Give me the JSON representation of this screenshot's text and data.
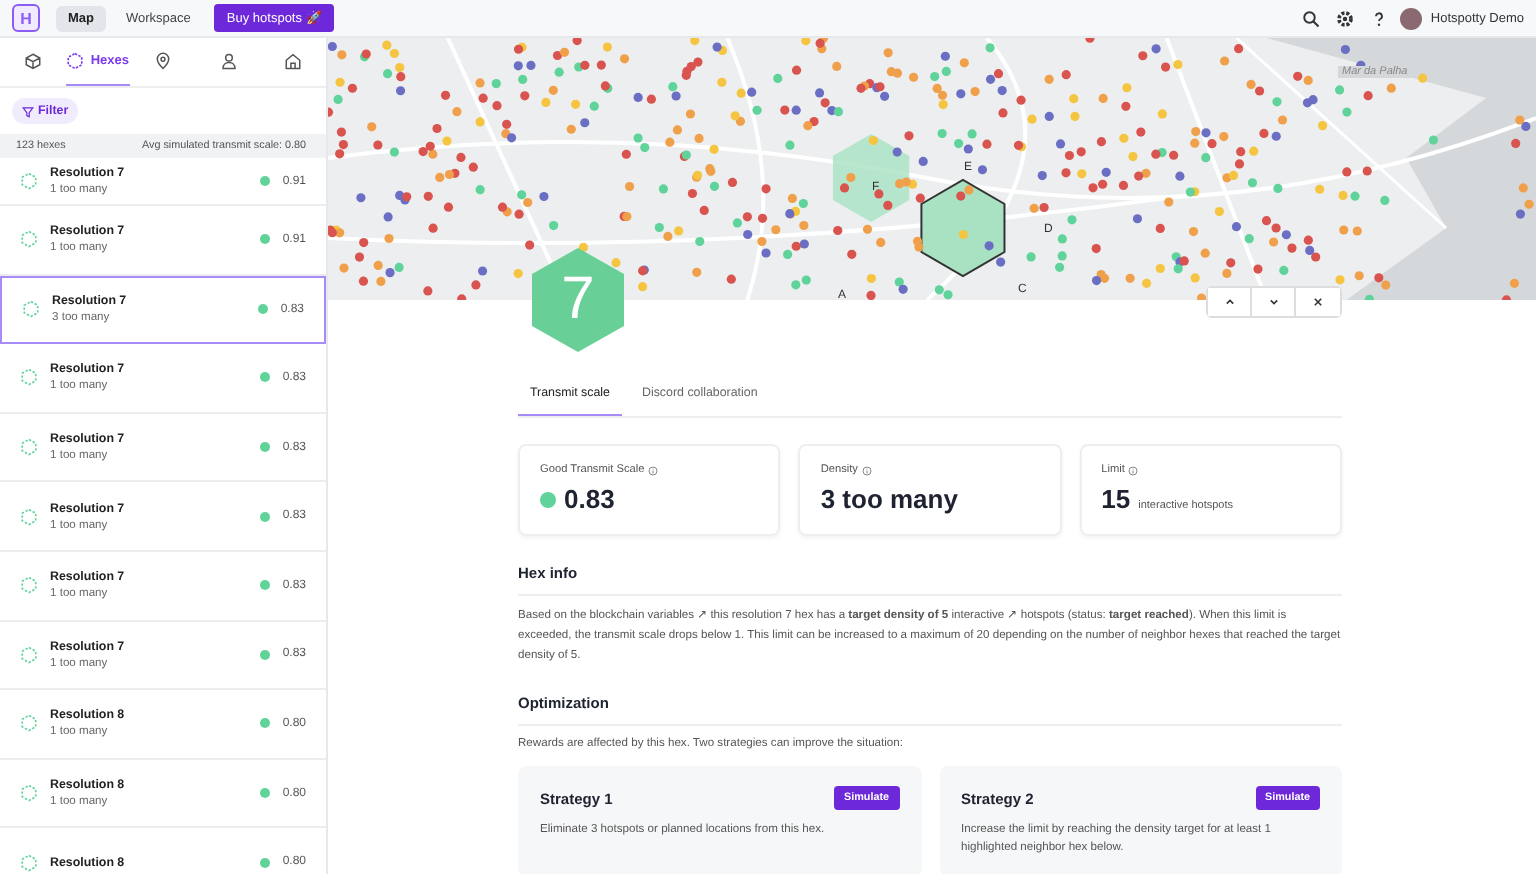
{
  "topbar": {
    "logo": "H",
    "nav": [
      {
        "label": "Map",
        "selected": true
      },
      {
        "label": "Workspace",
        "selected": false
      }
    ],
    "buy_button": "Buy hotspots 🚀",
    "user": "Hotspotty Demo"
  },
  "sidebar": {
    "tabs": [
      {
        "kind": "cube",
        "selected": false
      },
      {
        "kind": "hex",
        "label": "Hexes",
        "selected": true
      },
      {
        "kind": "pin",
        "selected": false
      },
      {
        "kind": "person",
        "selected": false
      },
      {
        "kind": "home",
        "selected": false
      }
    ],
    "filter": "Filter",
    "count": "123 hexes",
    "average": "Avg simulated transmit scale: 0.80",
    "hexes": [
      {
        "title": "Resolution 7",
        "subtitle": "1 too many",
        "score": "0.91",
        "color": "#5fd39a",
        "selected": false
      },
      {
        "title": "Resolution 7",
        "subtitle": "1 too many",
        "score": "0.91",
        "color": "#5fd39a",
        "selected": false
      },
      {
        "title": "Resolution 7",
        "subtitle": "3 too many",
        "score": "0.83",
        "color": "#5fd39a",
        "selected": true
      },
      {
        "title": "Resolution 7",
        "subtitle": "1 too many",
        "score": "0.83",
        "color": "#5fd39a",
        "selected": false
      },
      {
        "title": "Resolution 7",
        "subtitle": "1 too many",
        "score": "0.83",
        "color": "#5fd39a",
        "selected": false
      },
      {
        "title": "Resolution 7",
        "subtitle": "1 too many",
        "score": "0.83",
        "color": "#5fd39a",
        "selected": false
      },
      {
        "title": "Resolution 7",
        "subtitle": "1 too many",
        "score": "0.83",
        "color": "#5fd39a",
        "selected": false
      },
      {
        "title": "Resolution 7",
        "subtitle": "1 too many",
        "score": "0.83",
        "color": "#5fd39a",
        "selected": false
      },
      {
        "title": "Resolution 8",
        "subtitle": "1 too many",
        "score": "0.80",
        "color": "#5fd39a",
        "selected": false
      },
      {
        "title": "Resolution 8",
        "subtitle": "1 too many",
        "score": "0.80",
        "color": "#5fd39a",
        "selected": false
      },
      {
        "title": "Resolution 8",
        "score": "0.80",
        "color": "#5fd39a",
        "selected": false
      }
    ]
  },
  "map": {
    "water_label": "Mar da Palha",
    "region_labels": [
      "E",
      "F",
      "D",
      "A",
      "C"
    ]
  },
  "hex_badge": "7",
  "detail_tabs": [
    {
      "label": "Transmit scale",
      "selected": true
    },
    {
      "label": "Discord collaboration",
      "selected": false
    }
  ],
  "metrics": [
    {
      "label": "Good Transmit Scale",
      "value": "0.83",
      "color": "#5fd39a"
    },
    {
      "label": "Density",
      "value": "3 too many"
    },
    {
      "label": "Limit",
      "value": "15",
      "unit": "interactive hotspots"
    }
  ],
  "hex_info": {
    "title": "Hex info",
    "text": "Based on the blockchain variables ↗ this resolution 7 hex has a **target density of 5** interactive ↗ hotspots (status: **target reached**). When this limit is exceeded, the transmit scale drops below 1. This limit can be increased to a maximum of 20 depending on the number of neighbor hexes that reached the target density of 5."
  },
  "optimization": {
    "title": "Optimization",
    "intro": "Rewards are affected by this hex. Two strategies can improve the situation:",
    "strategies": [
      {
        "title": "Strategy 1",
        "button": "Simulate",
        "text": "Eliminate 3 hotspots or planned locations from this hex."
      },
      {
        "title": "Strategy 2",
        "button": "Simulate",
        "text": "Increase the limit by reaching the density target for at least 1 highlighted neighbor hex below."
      }
    ]
  }
}
